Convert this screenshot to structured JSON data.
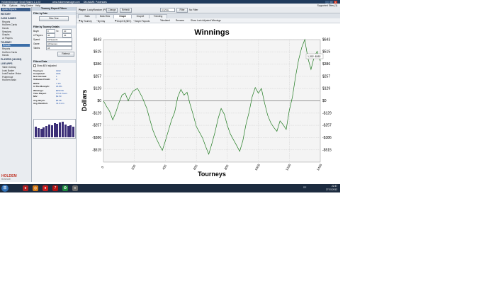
{
  "window": {
    "title": "HoldemManager Small Stakes 1.1.XX",
    "site": "www.holdemmanager.com",
    "db": "DB-NAME: Pokerstars"
  },
  "menu": {
    "items": [
      "File",
      "Options",
      "Help Centre",
      "Help"
    ],
    "right": "Supported Sites (3)"
  },
  "nav": {
    "header": "Quick Reports",
    "items": [
      {
        "label": "HISTORY",
        "group": true
      },
      {
        "label": "CASH GAMES",
        "group": true
      },
      {
        "label": "Reports"
      },
      {
        "label": "Hold'em Cards"
      },
      {
        "label": "Hands"
      },
      {
        "label": "Sessions"
      },
      {
        "label": "Graphs"
      },
      {
        "label": "vs Players"
      },
      {
        "label": "TOURNEY",
        "group": true
      },
      {
        "label": "Results",
        "selected": true
      },
      {
        "label": "Reports"
      },
      {
        "label": "Hold'em Cards"
      },
      {
        "label": "Hands"
      },
      {
        "label": "PLAYERS (14/1305)",
        "group": true
      },
      {
        "label": "LIVE APPS",
        "group": true
      },
      {
        "label": "Table Overlay"
      },
      {
        "label": "Leak Buster"
      },
      {
        "label": "LeakTracker Vision"
      },
      {
        "label": "Pokerenue"
      },
      {
        "label": "Hold'em Brain"
      }
    ],
    "logo": "HOLDEM",
    "logo_sub": "MANAGER"
  },
  "filters": {
    "title": "Tourney Report Filters",
    "by_date": "Filter by Date",
    "date_btn": "Disc Year",
    "by_details": "Filter by Tourney Details",
    "buyin_label": "Buyin",
    "buyin_from": "0",
    "buyin_to_label": "To",
    "buyin_to": "10",
    "players_label": "# Players",
    "players_from": "45",
    "players_to": "45",
    "speed_label": "Speed",
    "speed_value": "All Speeds",
    "game_label": "Game",
    "game_value": "All Games",
    "tables_label": "Tables",
    "tables_value": "All",
    "refresh_btn": "Refresh",
    "filtered_title": "Filtered Data",
    "show_adjusted": "Show $EV adjusted",
    "stats": [
      {
        "label": "Tourneys:",
        "value": "1302"
      },
      {
        "label": "  Completed:",
        "value": "1301"
      },
      {
        "label": "  Not Finished:",
        "value": "1"
      },
      {
        "label": "  Unknown Finish:",
        "value": "0"
      },
      {
        "label": "ROI%:",
        "value": "7.1%"
      },
      {
        "label": "In The Money%:",
        "value": "18.8%"
      },
      {
        "label": "Winnings:",
        "value": "$452.56"
      },
      {
        "label": "Time Played:",
        "value": "179.1 hours"
      },
      {
        "label": "$/hr:",
        "value": "$2.53"
      },
      {
        "label": "Avg. Buyin:",
        "value": "$5.68"
      },
      {
        "label": "Avg. Duration:",
        "value": "41.3 min"
      }
    ],
    "finish_dist": [
      15,
      13,
      12,
      14,
      16,
      18,
      17,
      20,
      19,
      21,
      22,
      18,
      16,
      17,
      15
    ],
    "bar_color": "#3c2f78"
  },
  "topbar": {
    "player_label": "Player",
    "player_value": "LuckyRandom (PS)",
    "change_btn": "Change",
    "refresh_btn": "Refresh",
    "site_select": "AnySite",
    "filter_btn": "Filter",
    "no_filter": "No Filter"
  },
  "tabs": [
    "Stats",
    "Data View",
    "Graph",
    "Graph2",
    "Trending"
  ],
  "active_tab": "Graph",
  "options": [
    "By Tourney",
    "By Day",
    "Graph $ ($EV)",
    "Graph Payouts",
    "Tabulated",
    "Rename",
    "Show Luck Adjusted Winnings"
  ],
  "chart_data": {
    "type": "line",
    "title": "Winnings",
    "xlabel": "Tourneys",
    "ylabel": "Dollars",
    "xlim": [
      0,
      1400
    ],
    "ylim": [
      -643,
      643
    ],
    "y_ticks": [
      643,
      515,
      386,
      257,
      129,
      0,
      -129,
      -257,
      -386,
      -515
    ],
    "y_tick_labels": [
      "$643",
      "$515",
      "$386",
      "$257",
      "$129",
      "$0",
      "-$129",
      "-$257",
      "-$386",
      "-$515"
    ],
    "x_ticks": [
      0,
      200,
      400,
      600,
      800,
      1000,
      1200,
      1400
    ],
    "grid": true,
    "line_color": "#1f7a1f",
    "series": [
      {
        "x": [
          0,
          20,
          40,
          60,
          80,
          100,
          120,
          140,
          160,
          170,
          190,
          220,
          250,
          280,
          300,
          320,
          340,
          360,
          380,
          400,
          420,
          440,
          460,
          480,
          500,
          520,
          540,
          560,
          580,
          600,
          620,
          640,
          660,
          680,
          700,
          720,
          740,
          760,
          780,
          800,
          820,
          840,
          860,
          880,
          900,
          920,
          940,
          960,
          980,
          1000,
          1020,
          1040,
          1060,
          1080,
          1100,
          1120,
          1140,
          1160,
          1180,
          1200,
          1220,
          1240,
          1260,
          1280,
          1300,
          1320,
          1340,
          1360,
          1380,
          1400
        ],
        "values": [
          0,
          -60,
          -110,
          -200,
          -120,
          -20,
          60,
          80,
          0,
          40,
          100,
          130,
          40,
          -80,
          -200,
          -310,
          -390,
          -460,
          -520,
          -420,
          -310,
          -200,
          -120,
          40,
          120,
          60,
          90,
          -40,
          -150,
          -270,
          -330,
          -390,
          -480,
          -560,
          -450,
          -330,
          -190,
          -80,
          -140,
          -260,
          -350,
          -410,
          -470,
          -530,
          -420,
          -250,
          -120,
          40,
          140,
          80,
          130,
          -20,
          -150,
          -230,
          -280,
          -320,
          -210,
          -250,
          -300,
          -100,
          40,
          250,
          430,
          560,
          643,
          450,
          330,
          460,
          520,
          420
        ]
      }
    ],
    "tooltip": "1,302: $452"
  },
  "taskbar": {
    "icons": [
      {
        "glyph": "♠",
        "color": "#b02020"
      },
      {
        "glyph": "◎",
        "color": "#d77a16"
      },
      {
        "glyph": "●",
        "color": "#c81c1c"
      },
      {
        "glyph": "7",
        "color": "#b01010"
      },
      {
        "glyph": "✪",
        "color": "#1c8a3c"
      },
      {
        "glyph": "≡",
        "color": "#6a6a6a"
      }
    ],
    "tray": "DE",
    "time": "22:47",
    "date": "27.03.2012"
  }
}
